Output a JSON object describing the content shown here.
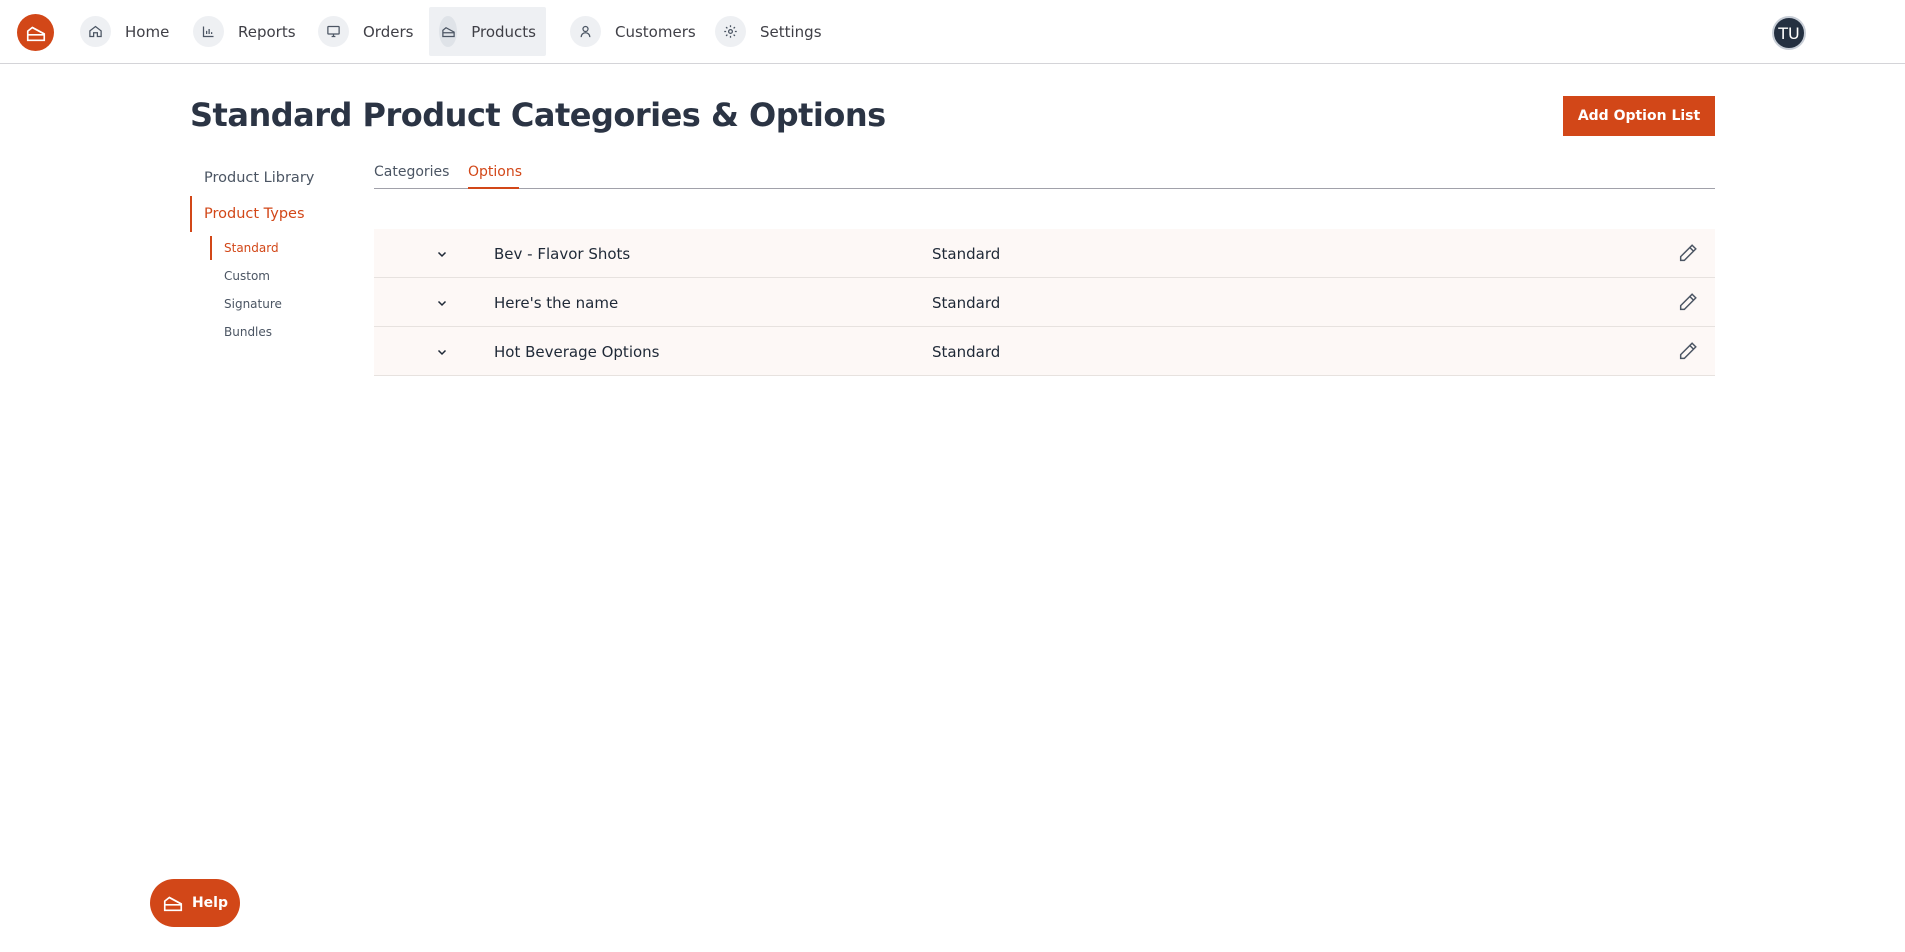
{
  "nav": {
    "items": [
      {
        "label": "Home",
        "icon": "home-icon"
      },
      {
        "label": "Reports",
        "icon": "bar-chart-icon"
      },
      {
        "label": "Orders",
        "icon": "monitor-icon"
      },
      {
        "label": "Products",
        "icon": "cake-icon",
        "active": true
      },
      {
        "label": "Customers",
        "icon": "user-icon"
      },
      {
        "label": "Settings",
        "icon": "gear-icon"
      }
    ],
    "user_initials": "TU"
  },
  "header": {
    "title": "Standard Product Categories & Options",
    "add_button_label": "Add Option List"
  },
  "sidebar": {
    "items": [
      {
        "label": "Product Library"
      },
      {
        "label": "Product Types",
        "active": true
      }
    ],
    "sub_items": [
      {
        "label": "Standard",
        "active": true
      },
      {
        "label": "Custom"
      },
      {
        "label": "Signature"
      },
      {
        "label": "Bundles"
      }
    ]
  },
  "tabs": [
    {
      "label": "Categories"
    },
    {
      "label": "Options",
      "active": true
    }
  ],
  "option_lists": [
    {
      "name": "Bev - Flavor Shots",
      "type": "Standard"
    },
    {
      "name": "Here's the name",
      "type": "Standard"
    },
    {
      "name": "Hot Beverage Options",
      "type": "Standard"
    }
  ],
  "help": {
    "label": "Help"
  },
  "colors": {
    "accent": "#d24718",
    "title": "#2b3444",
    "row_bg": "#fdf8f6"
  }
}
